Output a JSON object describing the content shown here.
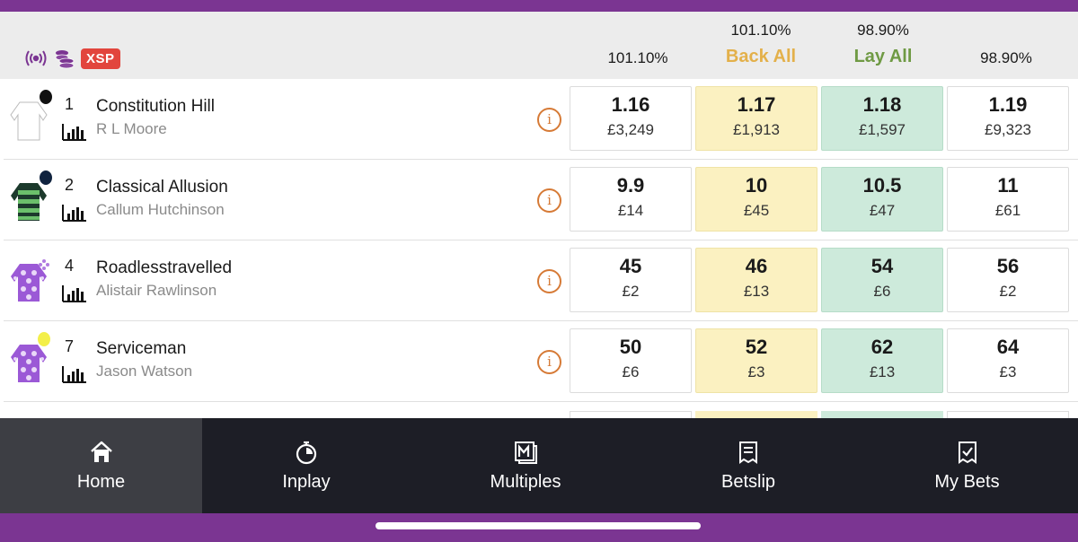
{
  "header": {
    "xsp_label": "XSP",
    "back_best_pct": "101.10%",
    "back_all_pct": "101.10%",
    "back_all_label": "Back All",
    "lay_all_pct": "98.90%",
    "lay_all_label": "Lay All",
    "lay_best_pct": "98.90%"
  },
  "runners": [
    {
      "number": "1",
      "name": "Constitution Hill",
      "jockey": "R L Moore",
      "prices": [
        {
          "odds": "1.16",
          "stake": "£3,249"
        },
        {
          "odds": "1.17",
          "stake": "£1,913"
        },
        {
          "odds": "1.18",
          "stake": "£1,597"
        },
        {
          "odds": "1.19",
          "stake": "£9,323"
        }
      ]
    },
    {
      "number": "2",
      "name": "Classical Allusion",
      "jockey": "Callum Hutchinson",
      "prices": [
        {
          "odds": "9.9",
          "stake": "£14"
        },
        {
          "odds": "10",
          "stake": "£45"
        },
        {
          "odds": "10.5",
          "stake": "£47"
        },
        {
          "odds": "11",
          "stake": "£61"
        }
      ]
    },
    {
      "number": "4",
      "name": "Roadlesstravelled",
      "jockey": "Alistair Rawlinson",
      "prices": [
        {
          "odds": "45",
          "stake": "£2"
        },
        {
          "odds": "46",
          "stake": "£13"
        },
        {
          "odds": "54",
          "stake": "£6"
        },
        {
          "odds": "56",
          "stake": "£2"
        }
      ]
    },
    {
      "number": "7",
      "name": "Serviceman",
      "jockey": "Jason Watson",
      "prices": [
        {
          "odds": "50",
          "stake": "£6"
        },
        {
          "odds": "52",
          "stake": "£3"
        },
        {
          "odds": "62",
          "stake": "£13"
        },
        {
          "odds": "64",
          "stake": "£3"
        }
      ]
    }
  ],
  "nav": {
    "home": "Home",
    "inplay": "Inplay",
    "multiples": "Multiples",
    "betslip": "Betslip",
    "mybets": "My Bets"
  },
  "colors": {
    "brand_purple": "#7b3592",
    "back_bg": "#fbf1c1",
    "lay_bg": "#cdeadb",
    "back_all": "#e3b04a",
    "lay_all": "#6f9a44",
    "xsp_badge": "#e2453d",
    "info_icon": "#d67a36"
  }
}
